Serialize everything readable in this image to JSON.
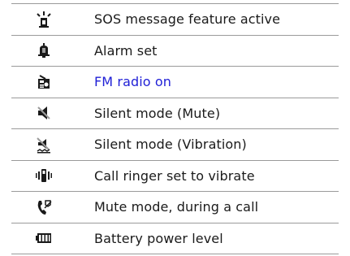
{
  "rows": [
    {
      "icon": "sos-icon",
      "label": "SOS message feature active"
    },
    {
      "icon": "alarm-bell-icon",
      "label": "Alarm set"
    },
    {
      "icon": "fm-radio-icon",
      "label": "FM radio on",
      "color": "#1f1fd6"
    },
    {
      "icon": "speaker-mute-icon",
      "label": "Silent mode (Mute)"
    },
    {
      "icon": "silent-vibration-icon",
      "label": "Silent mode (Vibration)"
    },
    {
      "icon": "vibrate-icon",
      "label": "Call ringer set to vibrate"
    },
    {
      "icon": "call-mute-icon",
      "label": "Mute mode, during a call"
    },
    {
      "icon": "battery-icon",
      "label": "Battery power level"
    }
  ]
}
